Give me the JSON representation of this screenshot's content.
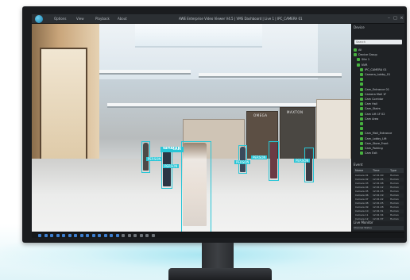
{
  "app": {
    "title": "AWE Enterprise Video Viewer V4.5 | VMS Dashboard | Live 1 | IPC_CAMERA 01",
    "menu": [
      "Options",
      "View",
      "Playback",
      "About"
    ],
    "window_controls": [
      "minimize",
      "maximize",
      "close"
    ]
  },
  "video": {
    "store_signs": [
      "OMEGA",
      "MAXTON"
    ],
    "detections": [
      {
        "label": "WOMAN",
        "main": true
      },
      {
        "label": "PERSON"
      },
      {
        "label": "PERSON"
      },
      {
        "label": "PERSON"
      },
      {
        "label": "PERSON"
      },
      {
        "label": "PERSON"
      }
    ]
  },
  "panel": {
    "device_header": "Device",
    "search_placeholder": "Search",
    "tree": [
      "All",
      "Device Group",
      "Site 1",
      "NVR",
      "IPC_CAMERA 01",
      "Camera_Lobby_01",
      "",
      "",
      "Cam_Entrance 01",
      "Camera Mall 1F",
      "Cam Corridor",
      "Cam Hall",
      "Cam_Stairs",
      "Cam Lift 1F 02",
      "Cam Area",
      "",
      "",
      "Cam_Mall_Entrance",
      "Cam_Lobby_Lift",
      "Cam_Store_Front",
      "Cam_Parking",
      "Cam Exit"
    ],
    "event_header": "Event",
    "event_columns": [
      "Name",
      "Time",
      "Type"
    ],
    "events": [
      [
        "Camera 01",
        "12:01:00",
        "Human"
      ],
      [
        "Camera 02",
        "12:01:05",
        "Human"
      ],
      [
        "Camera 03",
        "12:01:08",
        "Human"
      ],
      [
        "Camera 04",
        "12:01:12",
        "Human"
      ],
      [
        "Camera 05",
        "12:01:15",
        "Human"
      ],
      [
        "Camera 06",
        "12:01:19",
        "Human"
      ],
      [
        "Camera 07",
        "12:01:22",
        "Human"
      ],
      [
        "Camera 08",
        "12:01:25",
        "Human"
      ],
      [
        "Camera 09",
        "12:01:28",
        "Human"
      ],
      [
        "Camera 10",
        "12:01:31",
        "Human"
      ],
      [
        "Camera 11",
        "12:01:34",
        "Human"
      ],
      [
        "Camera 12",
        "12:01:37",
        "Human"
      ]
    ],
    "live_header": "Live Monitor",
    "live_bar": "Channel   Status"
  },
  "toolbar": {
    "buttons": [
      "layout-1",
      "layout-4",
      "layout-9",
      "layout-16",
      "layout-25",
      "layout-36",
      "split",
      "grid",
      "snapshot",
      "record",
      "audio",
      "ptz",
      "zoom",
      "fullscreen",
      "settings",
      "prev",
      "next",
      "sequence",
      "alarm",
      "info"
    ]
  }
}
